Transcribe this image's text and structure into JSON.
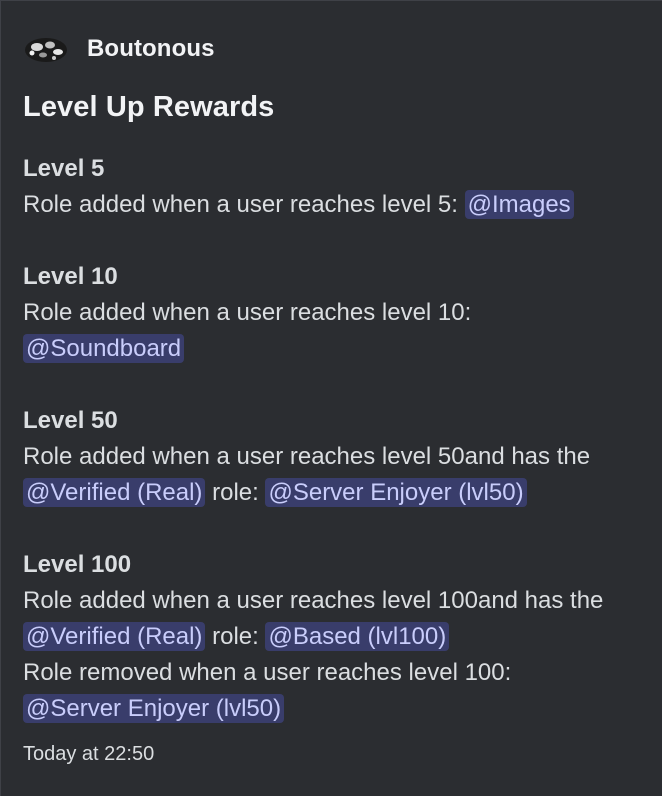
{
  "embed": {
    "author": {
      "name": "Boutonous",
      "avatar_icon": "bot-avatar-icon"
    },
    "title": "Level Up Rewards",
    "fields": [
      {
        "name": "Level 5",
        "text_1": "Role added when a user reaches level 5: ",
        "mention_1": "@Images"
      },
      {
        "name": "Level 10",
        "text_1": "Role added when a user reaches level 10: ",
        "mention_1": "@Soundboard"
      },
      {
        "name": "Level 50",
        "text_1": "Role added when a user reaches level 50and has the ",
        "mention_1": "@Verified (Real)",
        "text_2": " role: ",
        "mention_2": "@Server Enjoyer (lvl50)"
      },
      {
        "name": "Level 100",
        "text_1": "Role added when a user reaches level 100and has the ",
        "mention_1": "@Verified (Real)",
        "text_2": " role: ",
        "mention_2": "@Based (lvl100)",
        "text_3": "Role removed when a user reaches level 100: ",
        "mention_3": "@Server Enjoyer (lvl50)"
      }
    ],
    "footer": "Today at 22:50"
  },
  "colors": {
    "background": "#2b2d31",
    "text": "#dbdee1",
    "mention_bg": "#3c4270",
    "mention_text": "#c9cdfb"
  }
}
